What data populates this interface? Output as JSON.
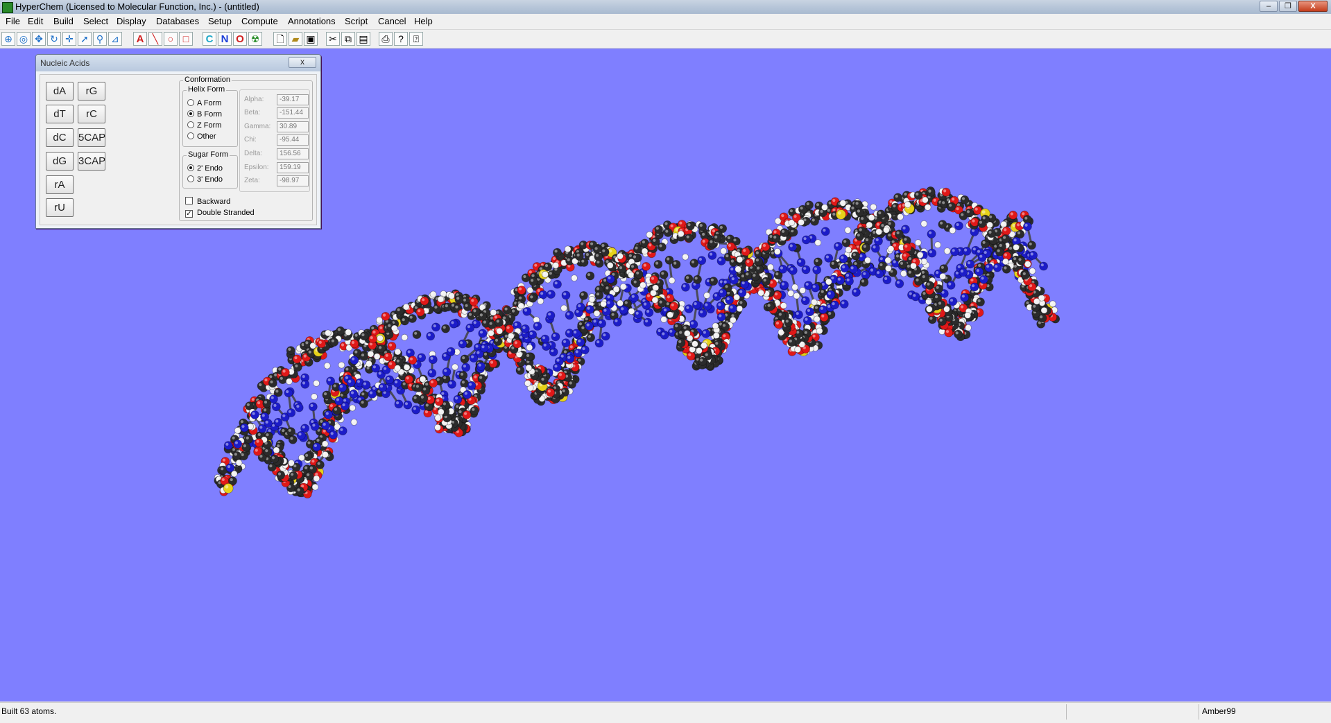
{
  "window": {
    "title": "HyperChem (Licensed to Molecular Function, Inc.) - (untitled)",
    "controls": [
      "–",
      "❐",
      "X"
    ]
  },
  "menu": [
    "File",
    "Edit",
    "Build",
    "Select",
    "Display",
    "Databases",
    "Setup",
    "Compute",
    "Annotations",
    "Script",
    "Cancel",
    "Help"
  ],
  "toolbar": {
    "element_c": "C",
    "element_n": "N",
    "element_o": "O"
  },
  "nucleic_dialog": {
    "title": "Nucleic Acids",
    "close": "x",
    "buttons_left": [
      "dA",
      "dT",
      "dC",
      "dG",
      "rA",
      "rU"
    ],
    "buttons_right": [
      "rG",
      "rC",
      "5CAP",
      "3CAP"
    ],
    "conformation_label": "Conformation",
    "helix_label": "Helix Form",
    "helix_options": [
      "A Form",
      "B Form",
      "Z Form",
      "Other"
    ],
    "helix_selected": "B Form",
    "sugar_label": "Sugar Form",
    "sugar_options": [
      "2' Endo",
      "3' Endo"
    ],
    "sugar_selected": "2' Endo",
    "angles": [
      {
        "label": "Alpha:",
        "value": "-39.17"
      },
      {
        "label": "Beta:",
        "value": "-151.44"
      },
      {
        "label": "Gamma:",
        "value": "30.89"
      },
      {
        "label": "Chi:",
        "value": "-95.44"
      },
      {
        "label": "Delta:",
        "value": "156.56"
      },
      {
        "label": "Epsilon:",
        "value": "159.19"
      },
      {
        "label": "Zeta:",
        "value": "-98.97"
      }
    ],
    "backward_label": "Backward",
    "backward_checked": false,
    "double_label": "Double Stranded",
    "double_checked": true
  },
  "workspace": {
    "background": "#7f7fff",
    "atom_colors": {
      "carbon": "#2b2b2b",
      "nitrogen": "#1c1cc8",
      "oxygen": "#e01818",
      "phosphorus": "#e6d21a",
      "hydrogen": "#f2f2f2"
    }
  },
  "status": {
    "message": "Built 63 atoms.",
    "middle": "",
    "forcefield": "Amber99"
  }
}
